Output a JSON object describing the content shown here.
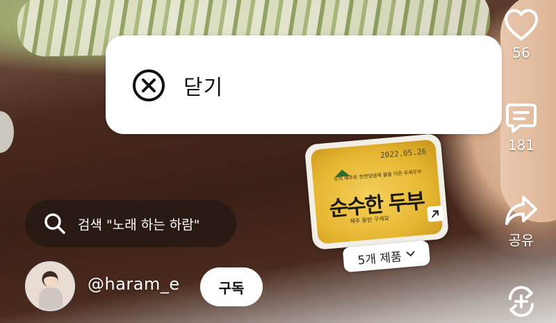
{
  "close_popup": {
    "label": "닫기",
    "icon": "close-circle-icon"
  },
  "actions": {
    "like_count": "56",
    "comment_count": "181",
    "share_label": "공유",
    "remix_icon": "remix-icon"
  },
  "product": {
    "pack_date": "2022.05.26",
    "pack_tagline": "오직 제주돈 천연양념에 물을 이은 두제두부",
    "pack_brand": "순수한 두부",
    "pack_sub": "제주 동빈 구세요",
    "products_label": "5개 제품"
  },
  "search": {
    "text": "검색 \"노래 하는 하람\""
  },
  "creator": {
    "username": "@haram_e",
    "subscribe_label": "구독"
  },
  "colors": {
    "popup_bg": "#ffffff",
    "search_bg": "#261814",
    "accent_white": "#ffffff"
  }
}
